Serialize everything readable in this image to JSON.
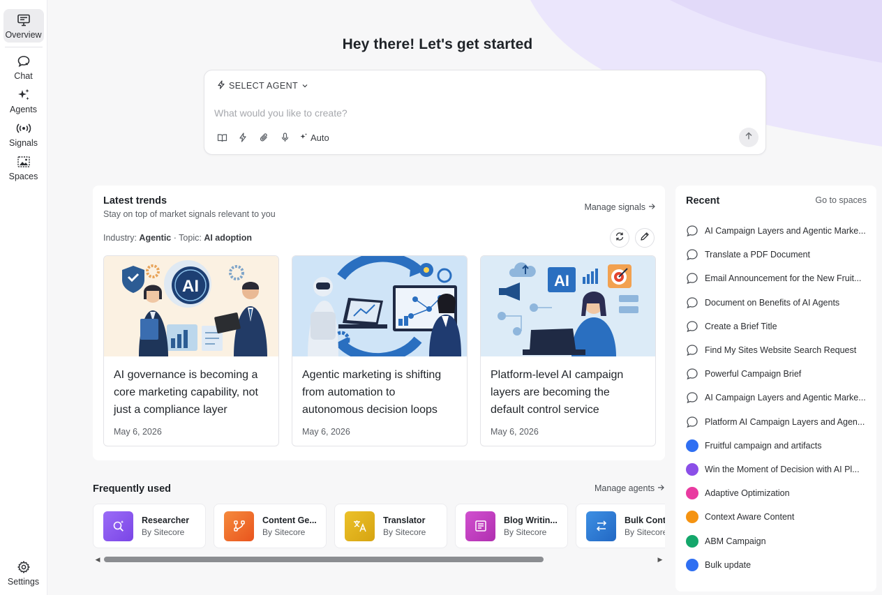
{
  "nav": {
    "items": [
      {
        "label": "Overview",
        "icon": "monitor-icon"
      },
      {
        "label": "Chat",
        "icon": "chat-icon"
      },
      {
        "label": "Agents",
        "icon": "sparkles-icon"
      },
      {
        "label": "Signals",
        "icon": "broadcast-icon"
      },
      {
        "label": "Spaces",
        "icon": "image-frame-icon"
      }
    ],
    "settings_label": "Settings"
  },
  "hero": {
    "title": "Hey there! Let's get started"
  },
  "prompt": {
    "agent_select_label": "SELECT AGENT",
    "placeholder": "What would you like to create?",
    "value": "",
    "auto_label": "Auto"
  },
  "trends": {
    "title": "Latest trends",
    "subtitle": "Stay on top of market signals relevant to you",
    "manage_label": "Manage signals",
    "industry_prefix": "Industry:",
    "industry": "Agentic",
    "separator": "·",
    "topic_prefix": "Topic:",
    "topic": "AI adoption",
    "cards": [
      {
        "title": "AI governance is becoming a core marketing capability, not just a compliance layer",
        "date": "May 6, 2026",
        "image_text": "AI"
      },
      {
        "title": "Agentic marketing is shifting from automation to autonomous decision loops",
        "date": "May 6, 2026"
      },
      {
        "title": "Platform-level AI campaign layers are becoming the default control service",
        "date": "May 6, 2026",
        "image_text": "AI"
      }
    ]
  },
  "frequent": {
    "title": "Frequently used",
    "manage_label": "Manage agents",
    "agents": [
      {
        "name": "Researcher",
        "by": "By Sitecore",
        "color": "#8b5cf6"
      },
      {
        "name": "Content Ge...",
        "by": "By Sitecore",
        "color": "#f26b2b"
      },
      {
        "name": "Translator",
        "by": "By Sitecore",
        "color": "#e3b51b"
      },
      {
        "name": "Blog Writin...",
        "by": "By Sitecore",
        "color": "#c03fbf"
      },
      {
        "name": "Bulk Content Editor",
        "by": "By Sitecore",
        "color": "#2f7fd8"
      }
    ]
  },
  "recent": {
    "title": "Recent",
    "link_label": "Go to spaces",
    "items": [
      {
        "label": "AI Campaign Layers and Agentic Marke...",
        "kind": "chat"
      },
      {
        "label": "Translate a PDF Document",
        "kind": "chat"
      },
      {
        "label": "Email Announcement for the New Fruit...",
        "kind": "chat"
      },
      {
        "label": "Document on Benefits of AI Agents",
        "kind": "chat"
      },
      {
        "label": "Create a Brief Title",
        "kind": "chat"
      },
      {
        "label": "Find My Sites Website Search Request",
        "kind": "chat"
      },
      {
        "label": "Powerful Campaign Brief",
        "kind": "chat"
      },
      {
        "label": "AI Campaign Layers and Agentic Marke...",
        "kind": "chat"
      },
      {
        "label": "Platform AI Campaign Layers and Agen...",
        "kind": "chat"
      },
      {
        "label": "Fruitful campaign and artifacts",
        "kind": "space",
        "color": "#2f6ff2"
      },
      {
        "label": "Win the Moment of Decision with AI Pl...",
        "kind": "space",
        "color": "#8b4fe8"
      },
      {
        "label": "Adaptive Optimization",
        "kind": "space",
        "color": "#e93aa0"
      },
      {
        "label": "Context Aware Content",
        "kind": "space",
        "color": "#f59311"
      },
      {
        "label": "ABM Campaign",
        "kind": "space",
        "color": "#14a76b"
      },
      {
        "label": "Bulk update",
        "kind": "space",
        "color": "#2f6ff2"
      }
    ]
  },
  "colors": {
    "accent_lavender": "#ebe5fd"
  }
}
